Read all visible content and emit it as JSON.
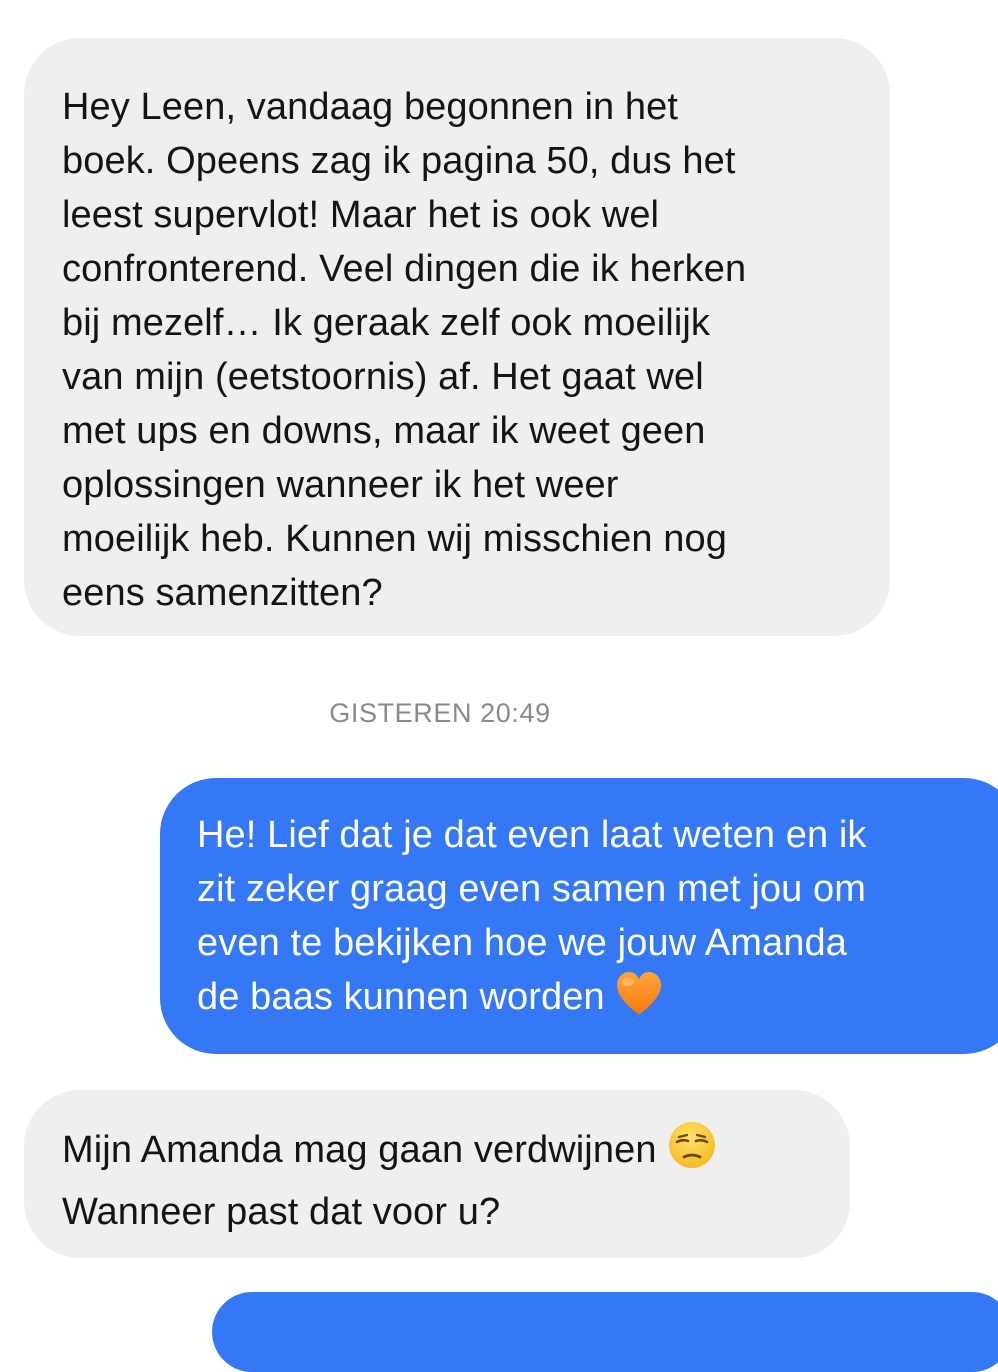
{
  "conversation": {
    "messages": [
      {
        "direction": "incoming",
        "lines": [
          "Hey Leen, vandaag begonnen in het",
          "boek. Opeens zag ik pagina 50, dus het",
          "leest supervlot! Maar het is ook wel",
          "confronterend. Veel dingen die ik herken",
          "bij mezelf… Ik geraak zelf ook moeilijk",
          "van mijn (eetstoornis) af. Het gaat wel",
          "met ups en downs, maar ik weet geen",
          "oplossingen wanneer ik het weer",
          "moeilijk heb. Kunnen wij misschien nog",
          "eens samenzitten?"
        ]
      },
      {
        "direction": "outgoing",
        "lines": [
          "He! Lief dat je dat even laat weten en ik",
          "zit zeker graag even samen met jou om",
          "even te bekijken hoe we jouw Amanda",
          "de baas kunnen worden"
        ],
        "emoji": "orange-heart"
      },
      {
        "direction": "incoming",
        "lines": [
          "Mijn Amanda mag gaan verdwijnen",
          "Wanneer past dat voor u?"
        ],
        "emoji": "unamused-face"
      }
    ],
    "timestamp": "GISTEREN 20:49"
  },
  "colors": {
    "incoming_bubble": "#efefef",
    "outgoing_bubble": "#3478f6",
    "incoming_text": "#141414",
    "outgoing_text": "#ffffff",
    "timestamp_text": "#8a8a8e"
  }
}
